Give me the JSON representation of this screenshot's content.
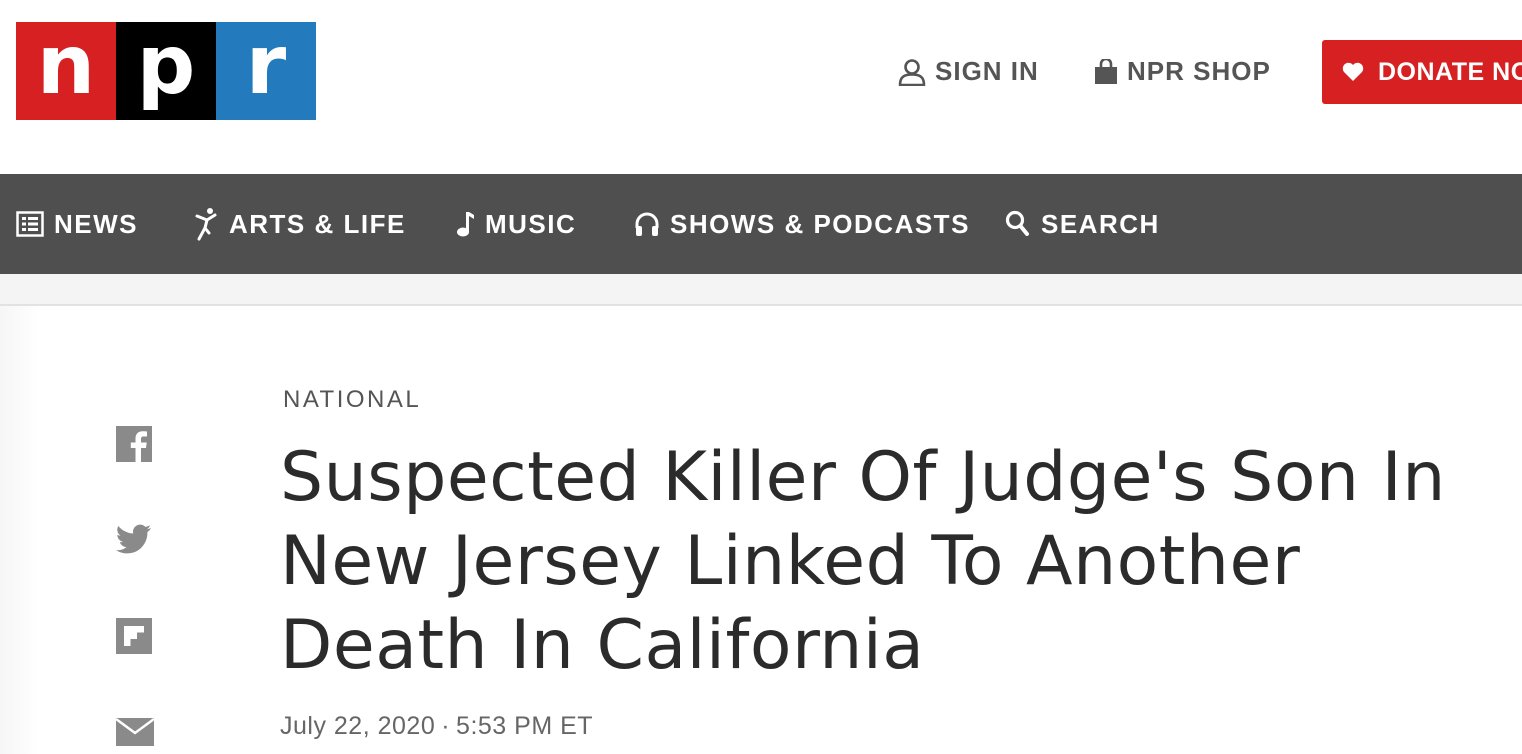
{
  "logo": {
    "letters": [
      "n",
      "p",
      "r"
    ],
    "colors": [
      "#d62021",
      "#000000",
      "#237bbd"
    ]
  },
  "header": {
    "sign_in_label": "SIGN IN",
    "shop_label": "NPR SHOP",
    "donate_label": "DONATE NOW"
  },
  "nav": {
    "items": [
      {
        "label": "NEWS",
        "icon": "news-list-icon"
      },
      {
        "label": "ARTS & LIFE",
        "icon": "dancer-icon"
      },
      {
        "label": "MUSIC",
        "icon": "music-note-icon"
      },
      {
        "label": "SHOWS & PODCASTS",
        "icon": "headphones-icon"
      },
      {
        "label": "SEARCH",
        "icon": "search-icon"
      }
    ]
  },
  "share": [
    "facebook-icon",
    "twitter-icon",
    "flipboard-icon",
    "email-icon"
  ],
  "article": {
    "slug": "National",
    "headline": "Suspected Killer Of Judge's Son In New Jersey Linked To Another Death In California",
    "date": "July 22, 2020",
    "separator": "·",
    "time": "5:53 PM ET"
  },
  "colors": {
    "brand_red": "#d62021",
    "nav_bg": "#4f4f4f"
  }
}
